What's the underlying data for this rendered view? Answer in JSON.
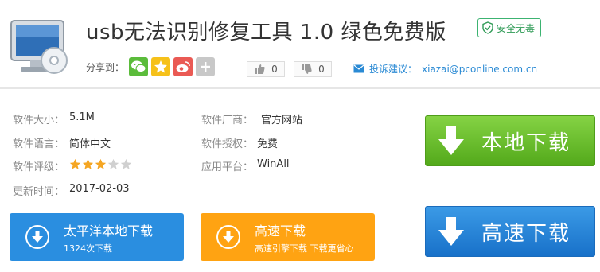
{
  "header": {
    "title": "usb无法识别修复工具 1.0 绿色免费版",
    "badge": "安全无毒"
  },
  "share": {
    "label": "分享到：",
    "icons": [
      "wechat-icon",
      "qzone-icon",
      "weibo-icon",
      "more-share-icon"
    ]
  },
  "votes": {
    "up": "0",
    "down": "0"
  },
  "complaint": {
    "label": "投诉建议：",
    "email": "xiazai@pconline.com.cn"
  },
  "info": {
    "size_label": "软件大小：",
    "size": "5.1M",
    "vendor_label": "软件厂商：",
    "vendor": "官方网站",
    "language_label": "软件语言：",
    "language": "简体中文",
    "license_label": "软件授权：",
    "license": "免费",
    "rating_label": "软件评级：",
    "rating": 3,
    "rating_max": 5,
    "platform_label": "应用平台：",
    "platform": "WinAll",
    "updated_label": "更新时间：",
    "updated": "2017-02-03"
  },
  "buttons": {
    "local_download": "本地下载",
    "fast_download": "高速下载",
    "pconline_main": "太平洋本地下载",
    "pconline_sub": "1324次下载",
    "highspeed_main": "高速下载",
    "highspeed_sub": "高速引擎下载 下载更省心"
  },
  "colors": {
    "green": "#5cb521",
    "blue": "#1e7fd6",
    "orange": "#ffa312",
    "star": "#f5a623",
    "link": "#2a8ad4"
  }
}
